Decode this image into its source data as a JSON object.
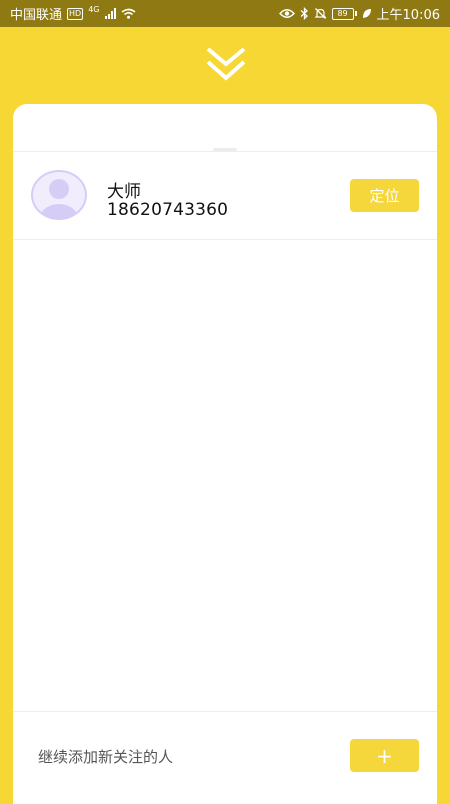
{
  "status_bar": {
    "carrier": "中国联通",
    "hd_badge": "HD",
    "network": "4G",
    "battery_level": "89",
    "time": "上午10:06"
  },
  "contacts": [
    {
      "name": "大师",
      "phone": "18620743360",
      "action_label": "定位"
    }
  ],
  "footer": {
    "add_text": "继续添加新关注的人",
    "add_button_label": "+"
  },
  "colors": {
    "brand_yellow": "#f7d733",
    "status_bar": "#8f7912",
    "button_yellow": "#f5d63b",
    "avatar_purple": "#d8d0f7"
  },
  "icons": {
    "collapse": "double-chevron-down-icon",
    "avatar": "person-avatar-icon"
  }
}
